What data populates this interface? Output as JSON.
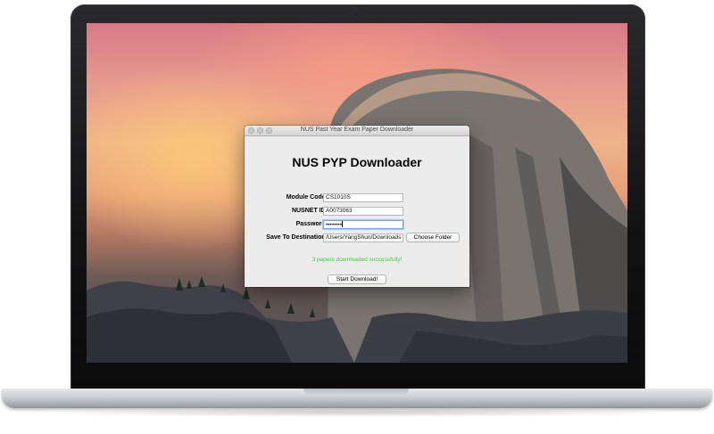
{
  "window": {
    "title": "NUS Past Year Exam Paper Downloader"
  },
  "app": {
    "heading": "NUS PYP Downloader",
    "fields": {
      "module_code": {
        "label": "Module Code:",
        "value": "CS1010S"
      },
      "nusnet_id": {
        "label": "NUSNET ID:",
        "value": "A0073063"
      },
      "password": {
        "label": "Password:",
        "value": "••••••••"
      },
      "destination": {
        "label": "Save To Destination:",
        "value": "/Users/YangShun/Downloads"
      }
    },
    "choose_folder_label": "Choose Folder",
    "status": "3 papers downloaded successfully!",
    "start_label": "Start Download!"
  },
  "colors": {
    "status_text": "#3ad13a",
    "focus_ring": "#6fa6e8"
  },
  "icons": {
    "window_controls": [
      "close-button",
      "minimize-button",
      "zoom-button"
    ]
  }
}
